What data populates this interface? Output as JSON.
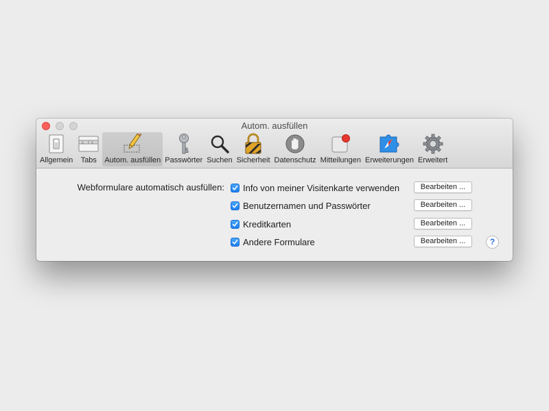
{
  "window": {
    "title": "Autom. ausfüllen"
  },
  "toolbar": {
    "items": [
      {
        "label": "Allgemein",
        "icon": "switch-icon"
      },
      {
        "label": "Tabs",
        "icon": "tabs-icon"
      },
      {
        "label": "Autom. ausfüllen",
        "icon": "pencil-form-icon",
        "active": true
      },
      {
        "label": "Passwörter",
        "icon": "key-icon"
      },
      {
        "label": "Suchen",
        "icon": "magnifier-icon"
      },
      {
        "label": "Sicherheit",
        "icon": "lock-icon"
      },
      {
        "label": "Datenschutz",
        "icon": "hand-icon"
      },
      {
        "label": "Mitteilungen",
        "icon": "notification-icon"
      },
      {
        "label": "Erweiterungen",
        "icon": "puzzle-compass-icon"
      },
      {
        "label": "Erweitert",
        "icon": "gear-icon"
      }
    ]
  },
  "autofill": {
    "section_label": "Webformulare automatisch ausfüllen:",
    "options": [
      {
        "label": "Info von meiner Visitenkarte verwenden",
        "checked": true,
        "button": "Bearbeiten ..."
      },
      {
        "label": "Benutzernamen und Passwörter",
        "checked": true,
        "button": "Bearbeiten ..."
      },
      {
        "label": "Kreditkarten",
        "checked": true,
        "button": "Bearbeiten ..."
      },
      {
        "label": "Andere Formulare",
        "checked": true,
        "button": "Bearbeiten ..."
      }
    ],
    "help": "?"
  },
  "colors": {
    "accent": "#1e7ff0",
    "close": "#fc605c",
    "background": "#ececec"
  }
}
